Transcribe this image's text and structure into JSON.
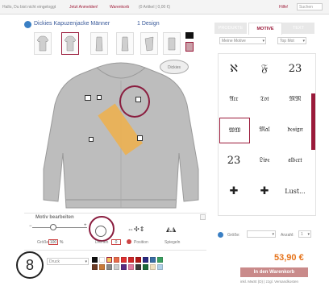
{
  "topbar": {
    "greeting": "Hallo, Du bist nicht eingeloggt",
    "login": "Jetzt Anmelden!",
    "cart": "Warenkorb",
    "cart_count": "(0 Artikel | 0,00 €)",
    "help": "Hilfe!",
    "search_placeholder": "Suchen"
  },
  "product": {
    "name": "Dickies Kapuzenjacke Männer",
    "design_count": "1 Design"
  },
  "tabs": [
    {
      "label": "PRODUKTE"
    },
    {
      "label": "MOTIVE"
    },
    {
      "label": "TEXT"
    }
  ],
  "motif_filters": {
    "category": "Meine Motive",
    "sort": "Top Mot"
  },
  "motifs": [
    "ℵ",
    "𝔉",
    "23",
    "𝔄𝔯𝔯",
    "𝔗𝔬𝔱",
    "𝔐𝔐",
    "𝔚𝔚",
    "𝔐𝔞𝔩",
    "𝔡𝔢𝔰𝔦𝔤𝔫",
    "23",
    "𝔏𝔦𝔳𝔢",
    "𝔞𝔩𝔟𝔢𝔯𝔱",
    "✚",
    "✚",
    "Lust..."
  ],
  "edit": {
    "title": "Motiv bearbeiten",
    "size_label": "Größe",
    "size_value": "100",
    "size_unit": "%",
    "rotate_label": "Drehen",
    "rotate_value": "0",
    "position_label": "Position",
    "mirror_label": "Spiegeln"
  },
  "print": {
    "method": "Druck",
    "size_label": "Größe:",
    "quantity_label": "Anzahl:",
    "quantity_value": "1"
  },
  "price": "53,90 €",
  "add_to_cart": "In den Warenkorb",
  "vat_note": "inkl. MwSt (D) | zzgl. Versandkosten",
  "step_badge": "8",
  "colors": {
    "accent": "#9a1a3a",
    "price": "#e6731a",
    "swatches": [
      "#111111",
      "#ffffff",
      "#f2c75a",
      "#e86a4a",
      "#e03030",
      "#d0282a",
      "#b01818",
      "#2a2a80",
      "#3a6ea5",
      "#3aa060",
      "#6b3b25",
      "#c87a3a",
      "#888888",
      "#cccccc",
      "#5a2a80",
      "#e07aa0",
      "#3a3a3a",
      "#1a6a3a",
      "#f0e0c0",
      "#b0d0e8"
    ]
  }
}
